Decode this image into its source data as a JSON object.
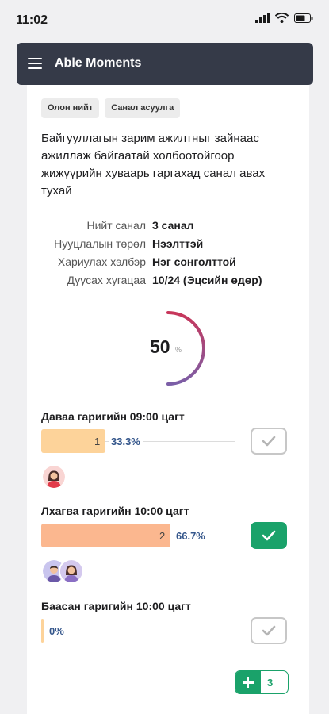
{
  "status_bar": {
    "time": "11:02"
  },
  "app": {
    "title": "Able Moments"
  },
  "poll": {
    "tags": [
      "Олон нийт",
      "Санал асуулга"
    ],
    "question": "Байгууллагын зарим ажилтныг зайнаас ажиллаж байгаатай холбоотойгоор жижүүрийн хуваарь гаргахад санал авах тухай",
    "meta": [
      {
        "label": "Нийт санал",
        "value": "3 санал"
      },
      {
        "label": "Нууцлалын төрөл",
        "value": "Нээлттэй"
      },
      {
        "label": "Хариулах хэлбэр",
        "value": "Нэг сонголттой"
      },
      {
        "label": "Дуусах хугацаа",
        "value": "10/24 (Эцсийн өдөр)"
      }
    ],
    "participation": {
      "percent": 50,
      "percent_text": "50",
      "unit": "%"
    },
    "options": [
      {
        "label": "Даваа гаригийн 09:00 цагт",
        "count": "1",
        "percent": "33.3%",
        "share": 0.333,
        "color": "#fdd39a",
        "selected": false,
        "voters": [
          "female-avatar"
        ]
      },
      {
        "label": "Лхагва гаригийн 10:00 цагт",
        "count": "2",
        "percent": "66.7%",
        "share": 0.667,
        "color": "#fbb78f",
        "selected": true,
        "voters": [
          "male-avatar",
          "female-avatar"
        ]
      },
      {
        "label": "Баасан гаригийн 10:00 цагт",
        "count": "",
        "percent": "0%",
        "share": 0,
        "color": "#fdd39a",
        "selected": false,
        "voters": []
      }
    ],
    "add_option": {
      "icon": "plus-icon",
      "count": "3"
    }
  },
  "colors": {
    "app_bar": "#353a48",
    "accent_green": "#1aa26a",
    "gauge_start": "#c8365a",
    "gauge_end": "#7b5ea7",
    "percent_text": "#34568b"
  }
}
